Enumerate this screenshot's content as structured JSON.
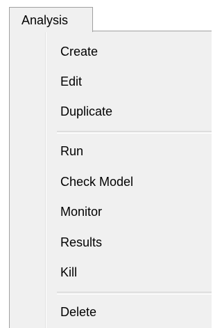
{
  "menu": {
    "title": "Analysis",
    "group1": [
      "Create",
      "Edit",
      "Duplicate"
    ],
    "group2": [
      "Run",
      "Check Model",
      "Monitor",
      "Results",
      "Kill"
    ],
    "group3": [
      "Delete"
    ]
  }
}
